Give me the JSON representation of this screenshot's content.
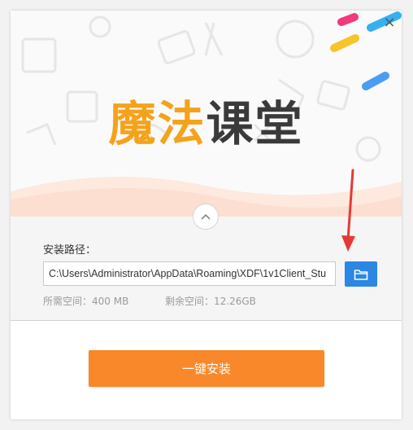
{
  "window": {
    "close_label": "×"
  },
  "hero": {
    "logo_part1": "魔法",
    "logo_part2": "课堂"
  },
  "install_path": {
    "label": "安装路径：",
    "value": "C:\\Users\\Administrator\\AppData\\Roaming\\XDF\\1v1Client_Stu",
    "browse_icon": "folder-icon"
  },
  "space": {
    "required": "所需空间：400 MB",
    "free": "剩余空间：12.26GB"
  },
  "install_button": {
    "label": "一键安装"
  },
  "colors": {
    "accent_orange": "#f8882a",
    "logo_orange": "#f5a21b",
    "browse_blue": "#2b86e4",
    "arrow_red": "#e53935"
  }
}
